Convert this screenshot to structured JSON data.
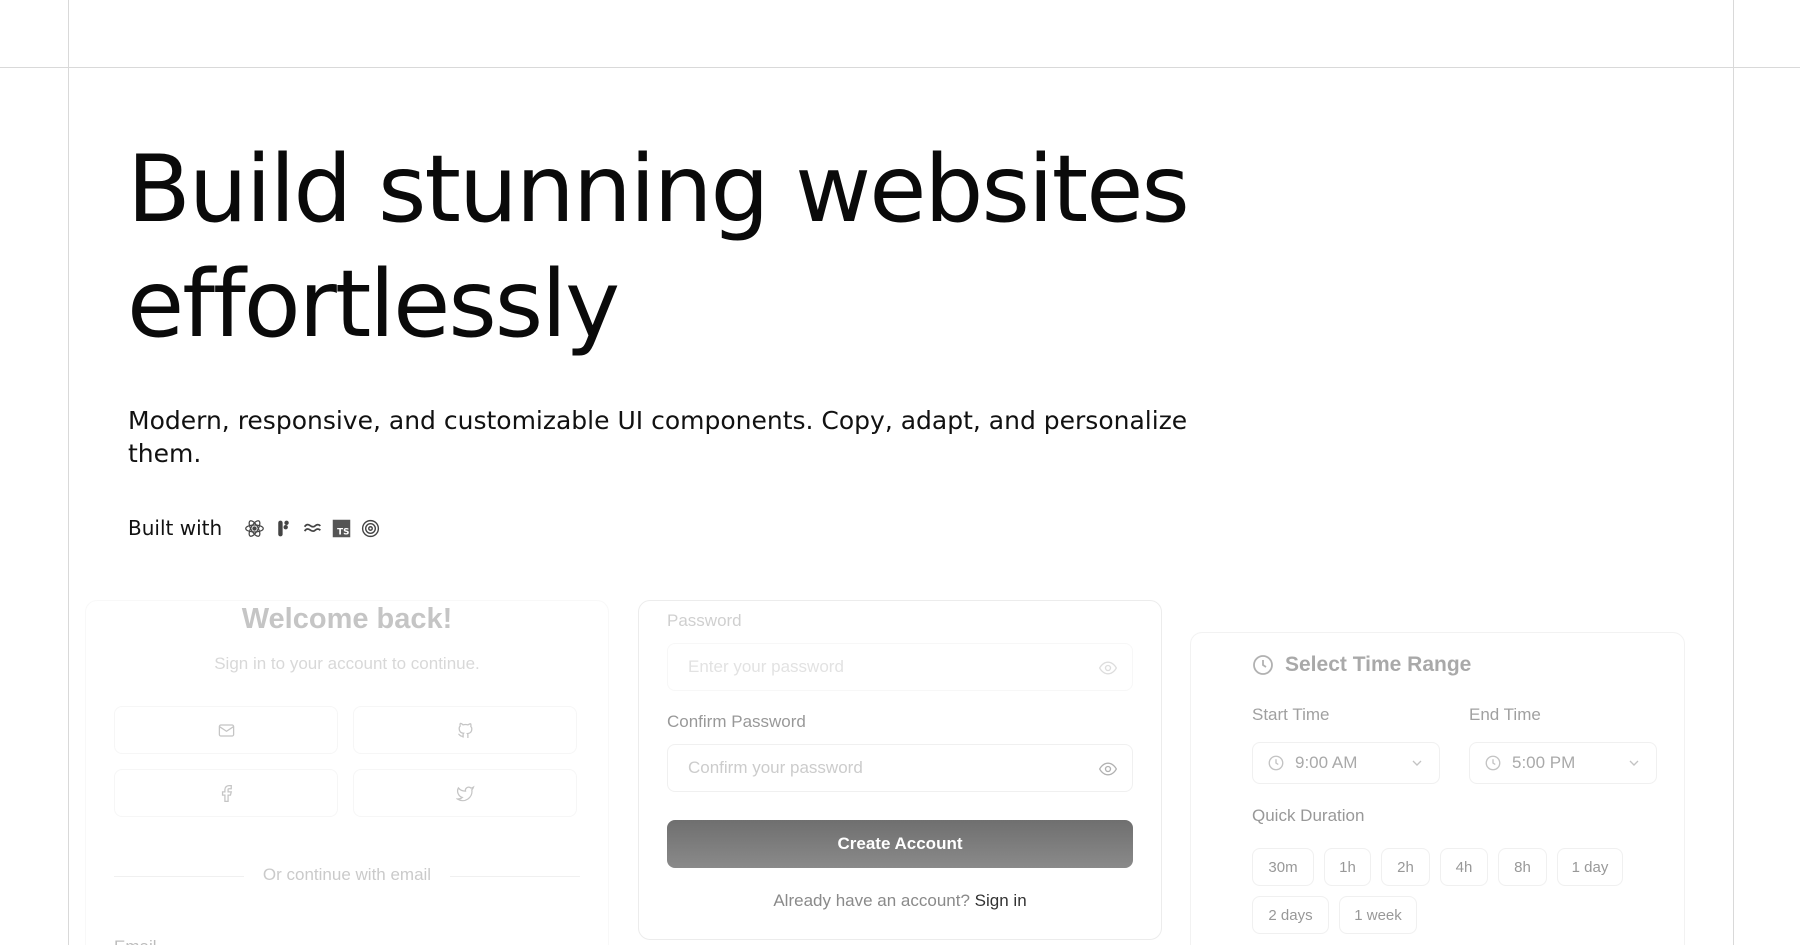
{
  "hero": {
    "title_line1": "Build stunning websites",
    "title_line2": "effortlessly",
    "subtitle_line1": "Modern, responsive, and customizable UI components. Copy, adapt, and personalize",
    "subtitle_line2": "them.",
    "built_with_label": "Built with",
    "tech_icons": [
      "react-icon",
      "framer-motion-icon",
      "tailwind-icon",
      "typescript-icon",
      "shadcn-icon"
    ]
  },
  "login_card": {
    "title": "Welcome back!",
    "subtitle": "Sign in to your account to continue.",
    "social_buttons": [
      "mail-icon",
      "github-icon",
      "facebook-icon",
      "twitter-icon"
    ],
    "divider_text": "Or continue with email",
    "email_label": "Email"
  },
  "signup_card": {
    "password_label": "Password",
    "password_placeholder": "Enter your password",
    "confirm_label": "Confirm Password",
    "confirm_placeholder": "Confirm your password",
    "create_button": "Create Account",
    "already_text": "Already have an account?",
    "sign_in_link": "Sign in"
  },
  "time_card": {
    "title": "Select Time Range",
    "start_label": "Start Time",
    "start_value": "9:00 AM",
    "end_label": "End Time",
    "end_value": "5:00 PM",
    "quick_label": "Quick Duration",
    "durations": [
      "30m",
      "1h",
      "2h",
      "4h",
      "8h",
      "1 day",
      "2 days",
      "1 week"
    ]
  },
  "colors": {
    "frame_line": "#d9d9d9",
    "button_bg": "#7a7a7a",
    "text": "#0a0a0a"
  }
}
